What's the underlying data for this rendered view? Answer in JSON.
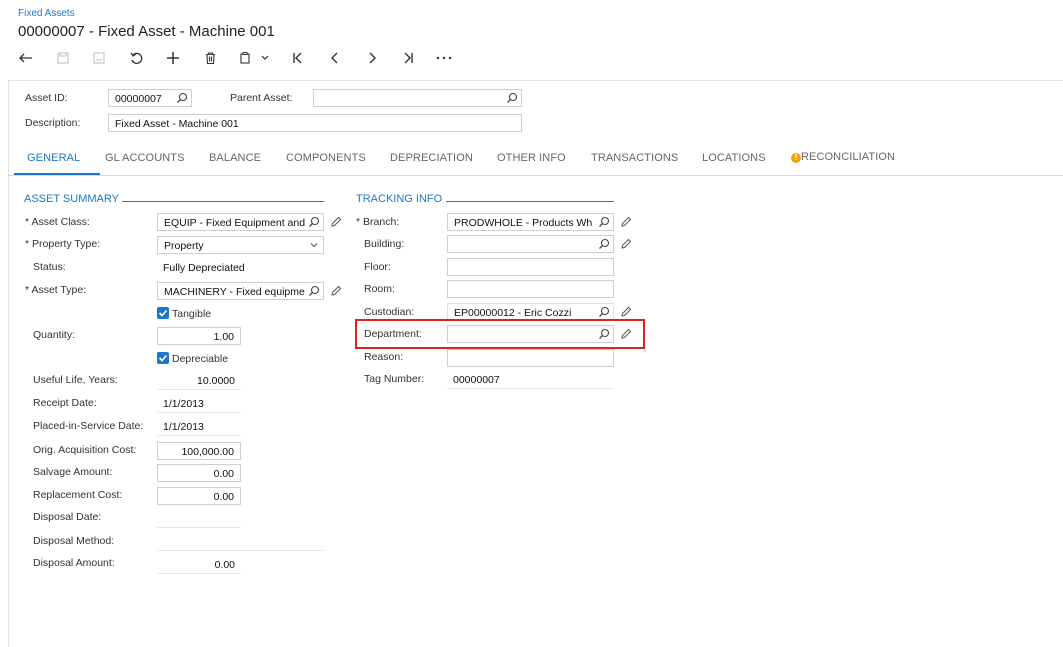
{
  "header": {
    "breadcrumb": "Fixed Assets",
    "title": "00000007 - Fixed Asset - Machine 001"
  },
  "toolbar": {
    "icons": [
      "undo-icon",
      "save-icon",
      "save-close-icon",
      "cancel-icon",
      "add-icon",
      "delete-icon",
      "copy-paste-icon",
      "first-icon",
      "previous-icon",
      "next-icon",
      "last-icon",
      "more-icon"
    ]
  },
  "form": {
    "asset_id_label": "Asset ID:",
    "asset_id_value": "00000007",
    "parent_asset_label": "Parent Asset:",
    "parent_asset_value": "",
    "description_label": "Description:",
    "description_value": "Fixed Asset - Machine 001"
  },
  "tabs": [
    {
      "label": "GENERAL",
      "active": true
    },
    {
      "label": "GL ACCOUNTS"
    },
    {
      "label": "BALANCE"
    },
    {
      "label": "COMPONENTS"
    },
    {
      "label": "DEPRECIATION"
    },
    {
      "label": "OTHER INFO"
    },
    {
      "label": "TRANSACTIONS"
    },
    {
      "label": "LOCATIONS"
    },
    {
      "label": "RECONCILIATION",
      "warning": true
    }
  ],
  "asset_summary": {
    "title": "ASSET SUMMARY",
    "asset_class_label": "Asset Class:",
    "asset_class_value": "EQUIP - Fixed Equipment and",
    "property_type_label": "Property Type:",
    "property_type_value": "Property",
    "status_label": "Status:",
    "status_value": "Fully Depreciated",
    "asset_type_label": "Asset Type:",
    "asset_type_value": "MACHINERY - Fixed equipme",
    "tangible_label": "Tangible",
    "quantity_label": "Quantity:",
    "quantity_value": "1.00",
    "depreciable_label": "Depreciable",
    "useful_life_label": "Useful Life, Years:",
    "useful_life_value": "10.0000",
    "receipt_date_label": "Receipt Date:",
    "receipt_date_value": "1/1/2013",
    "placed_in_service_label": "Placed-in-Service Date:",
    "placed_in_service_value": "1/1/2013",
    "orig_cost_label": "Orig. Acquisition Cost:",
    "orig_cost_value": "100,000.00",
    "salvage_label": "Salvage Amount:",
    "salvage_value": "0.00",
    "replacement_label": "Replacement Cost:",
    "replacement_value": "0.00",
    "disposal_date_label": "Disposal Date:",
    "disposal_date_value": "",
    "disposal_method_label": "Disposal Method:",
    "disposal_method_value": "",
    "disposal_amount_label": "Disposal Amount:",
    "disposal_amount_value": "0.00"
  },
  "tracking_info": {
    "title": "TRACKING INFO",
    "branch_label": "Branch:",
    "branch_value": "PRODWHOLE - Products Wh",
    "building_label": "Building:",
    "building_value": "",
    "floor_label": "Floor:",
    "floor_value": "",
    "room_label": "Room:",
    "room_value": "",
    "custodian_label": "Custodian:",
    "custodian_value": "EP00000012 - Eric Cozzi",
    "department_label": "Department:",
    "department_value": "",
    "reason_label": "Reason:",
    "reason_value": "",
    "tag_number_label": "Tag Number:",
    "tag_number_value": "00000007"
  },
  "colors": {
    "accent": "#1e78c8",
    "highlight": "#d9261c",
    "warning": "#f0a30a"
  }
}
